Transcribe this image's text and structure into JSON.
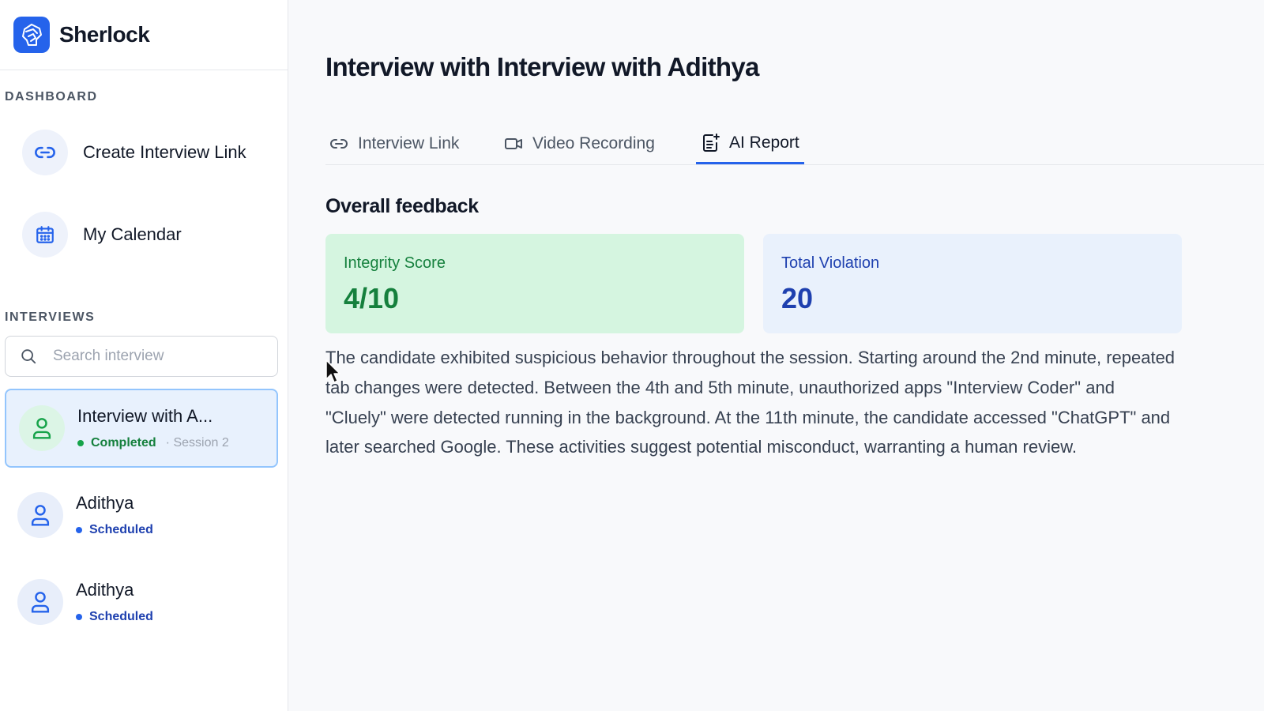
{
  "app": {
    "name": "Sherlock",
    "accent": "#2563eb"
  },
  "sidebar": {
    "dashboard_label": "DASHBOARD",
    "nav": [
      {
        "label": "Create Interview Link",
        "icon": "link-icon"
      },
      {
        "label": "My Calendar",
        "icon": "calendar-icon"
      }
    ],
    "interviews_label": "INTERVIEWS",
    "search_placeholder": "Search interview",
    "interviews": [
      {
        "title": "Interview with A...",
        "status": "Completed",
        "status_color": "#16a34a",
        "session": "· Session 2",
        "active": true
      },
      {
        "title": "Adithya",
        "status": "Scheduled",
        "status_color": "#2563eb",
        "session": "",
        "active": false
      },
      {
        "title": "Adithya",
        "status": "Scheduled",
        "status_color": "#2563eb",
        "session": "",
        "active": false
      }
    ]
  },
  "main": {
    "title": "Interview with Interview with Adithya",
    "tabs": [
      {
        "label": "Interview Link",
        "icon": "link-icon",
        "active": false
      },
      {
        "label": "Video Recording",
        "icon": "video-icon",
        "active": false
      },
      {
        "label": "AI Report",
        "icon": "report-icon",
        "active": true
      }
    ],
    "overall_feedback_title": "Overall feedback",
    "integrity": {
      "label": "Integrity Score",
      "value": "4/10",
      "bg": "#d5f5e0",
      "fg": "#15803d"
    },
    "violations": {
      "label": "Total Violation",
      "value": "20",
      "bg": "#e9f1fc",
      "fg": "#1e40af"
    },
    "feedback_text": "The candidate exhibited suspicious behavior throughout the session. Starting around the 2nd minute, repeated tab changes were detected. Between the 4th and 5th minute, unauthorized apps \"Interview Coder\" and \"Cluely\" were detected running in the background. At the 11th minute, the candidate accessed \"ChatGPT\" and later searched Google. These activities suggest potential misconduct, warranting a human review."
  }
}
